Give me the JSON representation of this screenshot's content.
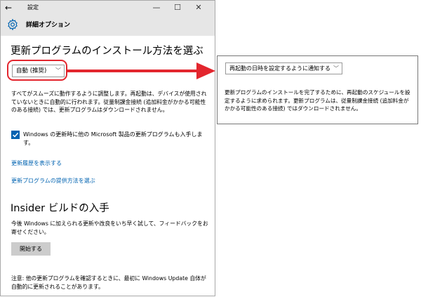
{
  "window": {
    "back_glyph": "←",
    "title": "設定",
    "minimize": "—",
    "maximize": "☐",
    "close": "✕"
  },
  "header": {
    "title": "詳細オプション"
  },
  "update_method": {
    "heading": "更新プログラムのインストール方法を選ぶ",
    "dropdown_value": "自動 (推奨)",
    "description": "すべてがスムーズに動作するように調整します。再起動は、デバイスが使用されていないときに自動的に行われます。従量制課金接続 (追加料金がかかる可能性のある接続) では、更新プログラムはダウンロードされません。",
    "checkbox_label": "Windows の更新時に他の Microsoft 製品の更新プログラムも入手します。",
    "checkbox_checked": true,
    "link_history": "更新履歴を表示する",
    "link_delivery": "更新プログラムの提供方法を選ぶ"
  },
  "insider": {
    "heading": "Insider ビルドの入手",
    "description": "今後 Windows に加えられる更新や改良をいち早く試して、フィードバックをお寄せください。",
    "button": "開始する"
  },
  "note": "注意: 他の更新プログラムを確認するときに、最初に Windows Update 自体が自動的に更新されることがあります。",
  "popup": {
    "dropdown_value": "再起動の日時を設定するように通知する",
    "description": "更新プログラムのインストールを完了するために、再起動のスケジュールを設定するように求められます。更新プログラムは、従量制課金接続 (追加料金がかかる可能性のある接続) ではダウンロードされません。"
  },
  "colors": {
    "accent": "#0063b1",
    "highlight": "#e3262e",
    "titlebar": "#e6e6e6"
  }
}
